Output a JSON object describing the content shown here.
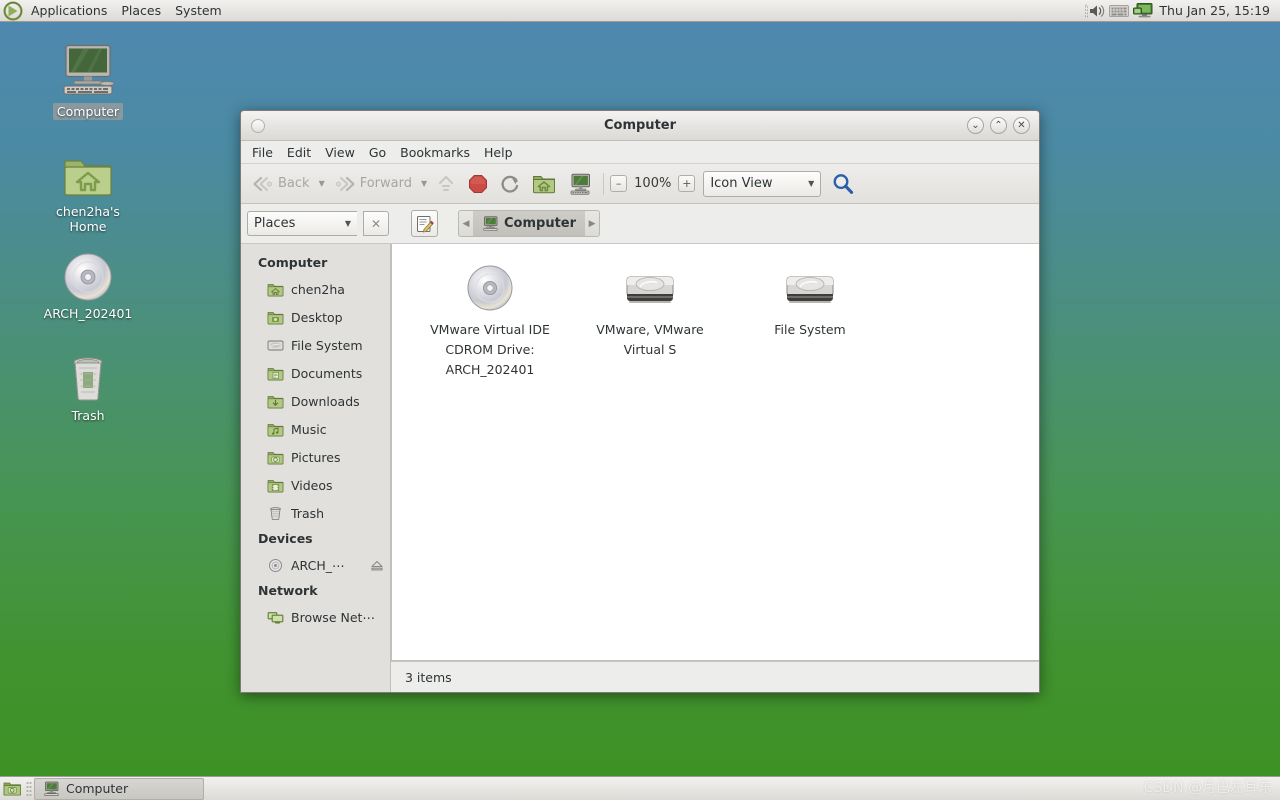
{
  "panel": {
    "logo_icon": "gnome-foot-icon",
    "menus": [
      {
        "label": "Applications"
      },
      {
        "label": "Places"
      },
      {
        "label": "System"
      }
    ],
    "tray": [
      {
        "icon": "volume-speaker-icon"
      },
      {
        "icon": "keyboard-indicator-icon"
      },
      {
        "icon": "network-monitor-icon"
      }
    ],
    "clock": "Thu Jan 25, 15:19"
  },
  "desktop": {
    "icons": [
      {
        "label": "Computer",
        "icon": "computer-icon",
        "selected": true
      },
      {
        "label": "chen2ha's Home",
        "icon": "home-folder-icon",
        "selected": false
      },
      {
        "label": "ARCH_202401",
        "icon": "cdrom-disc-icon",
        "selected": false
      },
      {
        "label": "Trash",
        "icon": "trash-icon",
        "selected": false
      }
    ]
  },
  "window": {
    "title": "Computer",
    "window_menu_icon": "window-menu-icon",
    "controls": [
      {
        "name": "minimize",
        "glyph": "⌄"
      },
      {
        "name": "maximize",
        "glyph": "⌃"
      },
      {
        "name": "close",
        "glyph": "✕"
      }
    ],
    "menubar": [
      "File",
      "Edit",
      "View",
      "Go",
      "Bookmarks",
      "Help"
    ],
    "toolbar": {
      "back_label": "Back",
      "forward_label": "Forward",
      "up_icon": "arrow-up-icon",
      "stop_icon": "stop-icon",
      "reload_icon": "reload-icon",
      "home_icon": "home-folder-icon",
      "computer_icon": "computer-icon",
      "zoom_out_glyph": "–",
      "zoom_level": "100%",
      "zoom_in_glyph": "+",
      "view_mode": "Icon View",
      "search_icon": "search-icon"
    },
    "locationbar": {
      "places_label": "Places",
      "close_glyph": "✕",
      "edit_icon": "edit-location-icon",
      "breadcrumb": {
        "prev_glyph": "◀",
        "next_glyph": "▶",
        "crumbs": [
          {
            "label": "Computer",
            "icon": "computer-icon",
            "active": true
          }
        ]
      }
    },
    "sidebar": {
      "sections": [
        {
          "header": "Computer",
          "items": [
            {
              "label": "chen2ha",
              "icon": "home-folder-icon"
            },
            {
              "label": "Desktop",
              "icon": "desktop-folder-icon"
            },
            {
              "label": "File System",
              "icon": "filesystem-icon"
            },
            {
              "label": "Documents",
              "icon": "documents-folder-icon"
            },
            {
              "label": "Downloads",
              "icon": "downloads-folder-icon"
            },
            {
              "label": "Music",
              "icon": "music-folder-icon"
            },
            {
              "label": "Pictures",
              "icon": "pictures-folder-icon"
            },
            {
              "label": "Videos",
              "icon": "videos-folder-icon"
            },
            {
              "label": "Trash",
              "icon": "trash-icon"
            }
          ]
        },
        {
          "header": "Devices",
          "items": [
            {
              "label": "ARCH_⋯",
              "icon": "cdrom-disc-icon",
              "eject": true
            }
          ]
        },
        {
          "header": "Network",
          "items": [
            {
              "label": "Browse Net⋯",
              "icon": "network-browse-icon"
            }
          ]
        }
      ]
    },
    "content": {
      "items": [
        {
          "label": "VMware Virtual IDE CDROM Drive: ARCH_202401",
          "icon": "cdrom-disc-icon"
        },
        {
          "label": "VMware, VMware Virtual S",
          "icon": "harddisk-icon"
        },
        {
          "label": "File System",
          "icon": "harddisk-icon"
        }
      ]
    },
    "statusbar": "3 items"
  },
  "taskbar": {
    "show_desktop_icon": "show-desktop-icon",
    "tasks": [
      {
        "label": "Computer",
        "icon": "computer-icon"
      }
    ]
  },
  "watermark": "CSDN @月巴左耳东",
  "colors": {
    "desktop_top": "#4f88b0",
    "desktop_bottom": "#3c9122",
    "panel_bg": "#e8e6e3",
    "window_bg": "#ededec",
    "sidebar_bg": "#e2e0dd",
    "accent_stop": "#cc4b44",
    "folder_green": "#8aa55a"
  }
}
